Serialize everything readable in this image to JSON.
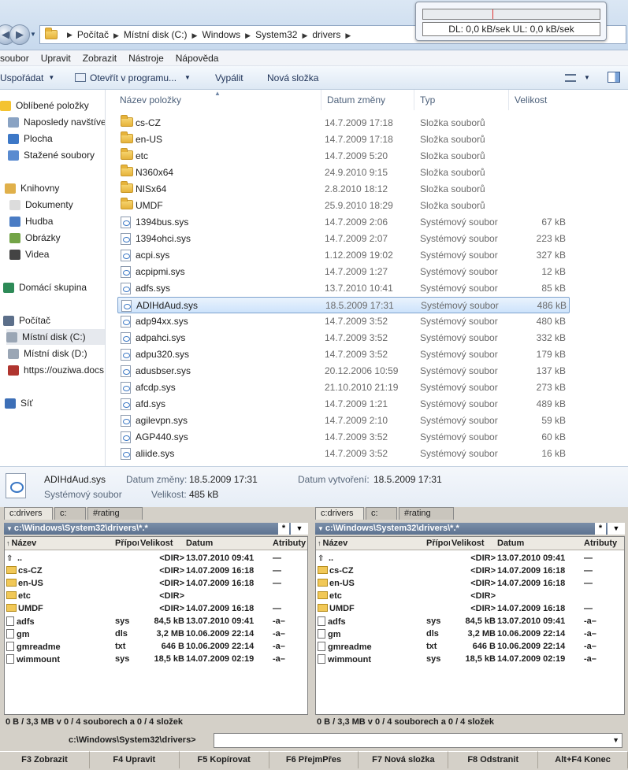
{
  "explorer": {
    "breadcrumb": [
      "Počítač",
      "Místní disk (C:)",
      "Windows",
      "System32",
      "drivers"
    ],
    "speed_widget": "DL: 0,0 kB/sek  UL: 0,0 kB/sek",
    "menu": [
      "soubor",
      "Upravit",
      "Zobrazit",
      "Nástroje",
      "Nápověda"
    ],
    "toolbar": {
      "organize": "Uspořádat",
      "open_with": "Otevřít v programu...",
      "burn": "Vypálit",
      "new_folder": "Nová složka"
    },
    "nav": [
      {
        "label": "Oblíbené položky",
        "icon": "star-icon"
      },
      {
        "label": "Naposledy navštívené",
        "icon": "recent-icon"
      },
      {
        "label": "Plocha",
        "icon": "desktop-icon"
      },
      {
        "label": "Stažené soubory",
        "icon": "downloads-icon"
      },
      {
        "label": "Knihovny",
        "icon": "libraries-icon"
      },
      {
        "label": "Dokumenty",
        "icon": "documents-icon"
      },
      {
        "label": "Hudba",
        "icon": "music-icon"
      },
      {
        "label": "Obrázky",
        "icon": "pictures-icon"
      },
      {
        "label": "Videa",
        "icon": "videos-icon"
      },
      {
        "label": "Domácí skupina",
        "icon": "homegroup-icon"
      },
      {
        "label": "Počítač",
        "icon": "computer-icon"
      },
      {
        "label": "Místní disk (C:)",
        "icon": "drive-icon"
      },
      {
        "label": "Místní disk (D:)",
        "icon": "drive-icon"
      },
      {
        "label": "https://ouziwa.docs",
        "icon": "network-drive-icon"
      },
      {
        "label": "Síť",
        "icon": "network-icon"
      }
    ],
    "columns": {
      "name": "Název položky",
      "date": "Datum změny",
      "type": "Typ",
      "size": "Velikost"
    },
    "files": [
      {
        "name": "cs-CZ",
        "date": "14.7.2009 17:18",
        "type": "Složka souborů",
        "size": "",
        "kind": "folder"
      },
      {
        "name": "en-US",
        "date": "14.7.2009 17:18",
        "type": "Složka souborů",
        "size": "",
        "kind": "folder"
      },
      {
        "name": "etc",
        "date": "14.7.2009 5:20",
        "type": "Složka souborů",
        "size": "",
        "kind": "folder"
      },
      {
        "name": "N360x64",
        "date": "24.9.2010 9:15",
        "type": "Složka souborů",
        "size": "",
        "kind": "folder"
      },
      {
        "name": "NISx64",
        "date": "2.8.2010 18:12",
        "type": "Složka souborů",
        "size": "",
        "kind": "folder"
      },
      {
        "name": "UMDF",
        "date": "25.9.2010 18:29",
        "type": "Složka souborů",
        "size": "",
        "kind": "folder"
      },
      {
        "name": "1394bus.sys",
        "date": "14.7.2009 2:06",
        "type": "Systémový soubor",
        "size": "67 kB",
        "kind": "sys"
      },
      {
        "name": "1394ohci.sys",
        "date": "14.7.2009 2:07",
        "type": "Systémový soubor",
        "size": "223 kB",
        "kind": "sys"
      },
      {
        "name": "acpi.sys",
        "date": "1.12.2009 19:02",
        "type": "Systémový soubor",
        "size": "327 kB",
        "kind": "sys"
      },
      {
        "name": "acpipmi.sys",
        "date": "14.7.2009 1:27",
        "type": "Systémový soubor",
        "size": "12 kB",
        "kind": "sys"
      },
      {
        "name": "adfs.sys",
        "date": "13.7.2010 10:41",
        "type": "Systémový soubor",
        "size": "85 kB",
        "kind": "sys"
      },
      {
        "name": "ADIHdAud.sys",
        "date": "18.5.2009 17:31",
        "type": "Systémový soubor",
        "size": "486 kB",
        "kind": "sys",
        "selected": true
      },
      {
        "name": "adp94xx.sys",
        "date": "14.7.2009 3:52",
        "type": "Systémový soubor",
        "size": "480 kB",
        "kind": "sys"
      },
      {
        "name": "adpahci.sys",
        "date": "14.7.2009 3:52",
        "type": "Systémový soubor",
        "size": "332 kB",
        "kind": "sys"
      },
      {
        "name": "adpu320.sys",
        "date": "14.7.2009 3:52",
        "type": "Systémový soubor",
        "size": "179 kB",
        "kind": "sys"
      },
      {
        "name": "adusbser.sys",
        "date": "20.12.2006 10:59",
        "type": "Systémový soubor",
        "size": "137 kB",
        "kind": "sys"
      },
      {
        "name": "afcdp.sys",
        "date": "21.10.2010 21:19",
        "type": "Systémový soubor",
        "size": "273 kB",
        "kind": "sys"
      },
      {
        "name": "afd.sys",
        "date": "14.7.2009 1:21",
        "type": "Systémový soubor",
        "size": "489 kB",
        "kind": "sys"
      },
      {
        "name": "agilevpn.sys",
        "date": "14.7.2009 2:10",
        "type": "Systémový soubor",
        "size": "59 kB",
        "kind": "sys"
      },
      {
        "name": "AGP440.sys",
        "date": "14.7.2009 3:52",
        "type": "Systémový soubor",
        "size": "60 kB",
        "kind": "sys"
      },
      {
        "name": "aliide.sys",
        "date": "14.7.2009 3:52",
        "type": "Systémový soubor",
        "size": "16 kB",
        "kind": "sys"
      }
    ],
    "details": {
      "name": "ADIHdAud.sys",
      "type": "Systémový soubor",
      "modified_label": "Datum změny:",
      "modified": "18.5.2009 17:31",
      "created_label": "Datum vytvoření:",
      "created": "18.5.2009 17:31",
      "size_label": "Velikost:",
      "size": "485 kB"
    }
  },
  "commander": {
    "panels": [
      {
        "tabs": [
          "c:drivers",
          "c:",
          "#rating"
        ],
        "path": "c:\\Windows\\System32\\drivers\\*.*",
        "columns": {
          "name": "Název",
          "ext": "Přípona",
          "size": "Velikost",
          "date": "Datum",
          "attr": "Atributy"
        },
        "rows": [
          {
            "name": "..",
            "ext": "",
            "size": "<DIR>",
            "date": "13.07.2010 09:41",
            "attr": "—",
            "kind": "up"
          },
          {
            "name": "cs-CZ",
            "ext": "",
            "size": "<DIR>",
            "date": "14.07.2009 16:18",
            "attr": "—",
            "kind": "folder"
          },
          {
            "name": "en-US",
            "ext": "",
            "size": "<DIR>",
            "date": "14.07.2009 16:18",
            "attr": "—",
            "kind": "folder"
          },
          {
            "name": "etc",
            "ext": "",
            "size": "<DIR>",
            "date": "",
            "attr": "",
            "kind": "folder"
          },
          {
            "name": "UMDF",
            "ext": "",
            "size": "<DIR>",
            "date": "14.07.2009 16:18",
            "attr": "—",
            "kind": "folder"
          },
          {
            "name": "adfs",
            "ext": "sys",
            "size": "84,5 kB",
            "date": "13.07.2010 09:41",
            "attr": "-a–",
            "kind": "file"
          },
          {
            "name": "gm",
            "ext": "dls",
            "size": "3,2 MB",
            "date": "10.06.2009 22:14",
            "attr": "-a–",
            "kind": "file"
          },
          {
            "name": "gmreadme",
            "ext": "txt",
            "size": "646 B",
            "date": "10.06.2009 22:14",
            "attr": "-a–",
            "kind": "file"
          },
          {
            "name": "wimmount",
            "ext": "sys",
            "size": "18,5 kB",
            "date": "14.07.2009 02:19",
            "attr": "-a–",
            "kind": "file"
          }
        ],
        "status": "0 B / 3,3 MB v 0 / 4 souborech a 0 / 4 složek"
      },
      {
        "tabs": [
          "c:drivers",
          "c:",
          "#rating"
        ],
        "path": "c:\\Windows\\System32\\drivers\\*.*",
        "columns": {
          "name": "Název",
          "ext": "Přípona",
          "size": "Velikost",
          "date": "Datum",
          "attr": "Atributy"
        },
        "rows": [
          {
            "name": "..",
            "ext": "",
            "size": "<DIR>",
            "date": "13.07.2010 09:41",
            "attr": "—",
            "kind": "up"
          },
          {
            "name": "cs-CZ",
            "ext": "",
            "size": "<DIR>",
            "date": "14.07.2009 16:18",
            "attr": "—",
            "kind": "folder"
          },
          {
            "name": "en-US",
            "ext": "",
            "size": "<DIR>",
            "date": "14.07.2009 16:18",
            "attr": "—",
            "kind": "folder"
          },
          {
            "name": "etc",
            "ext": "",
            "size": "<DIR>",
            "date": "",
            "attr": "",
            "kind": "folder"
          },
          {
            "name": "UMDF",
            "ext": "",
            "size": "<DIR>",
            "date": "14.07.2009 16:18",
            "attr": "—",
            "kind": "folder"
          },
          {
            "name": "adfs",
            "ext": "sys",
            "size": "84,5 kB",
            "date": "13.07.2010 09:41",
            "attr": "-a–",
            "kind": "file"
          },
          {
            "name": "gm",
            "ext": "dls",
            "size": "3,2 MB",
            "date": "10.06.2009 22:14",
            "attr": "-a–",
            "kind": "file"
          },
          {
            "name": "gmreadme",
            "ext": "txt",
            "size": "646 B",
            "date": "10.06.2009 22:14",
            "attr": "-a–",
            "kind": "file"
          },
          {
            "name": "wimmount",
            "ext": "sys",
            "size": "18,5 kB",
            "date": "14.07.2009 02:19",
            "attr": "-a–",
            "kind": "file"
          }
        ],
        "status": "0 B / 3,3 MB v 0 / 4 souborech a 0 / 4 složek"
      }
    ],
    "cmd_label": "c:\\Windows\\System32\\drivers>",
    "fkeys": [
      "F3 Zobrazit",
      "F4 Upravit",
      "F5 Kopírovat",
      "F6 PřejmPřes",
      "F7 Nová složka",
      "F8 Odstranit",
      "Alt+F4 Konec"
    ]
  }
}
